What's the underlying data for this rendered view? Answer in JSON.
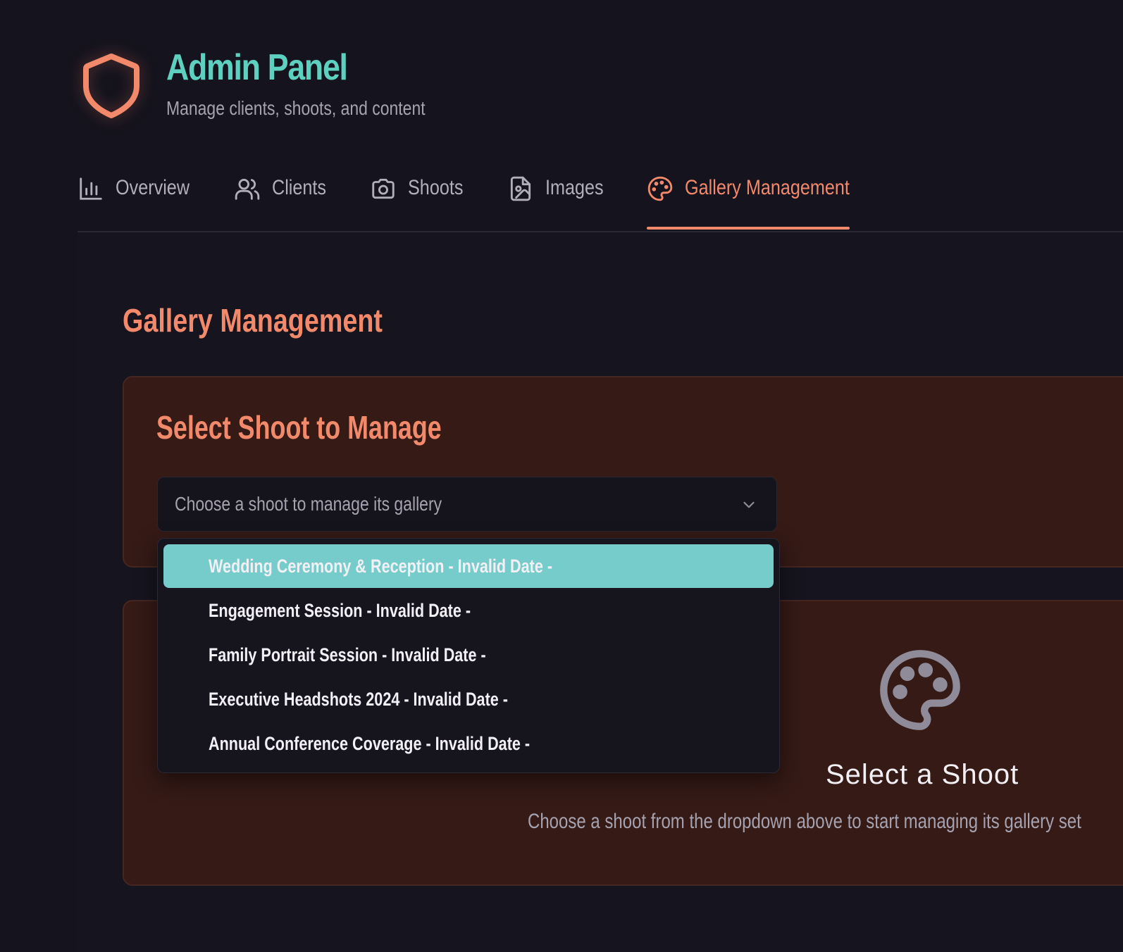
{
  "header": {
    "title": "Admin Panel",
    "subtitle": "Manage clients, shoots, and content",
    "icon": "shield-icon"
  },
  "tabs": [
    {
      "label": "Overview",
      "icon": "bar-chart-icon",
      "active": false
    },
    {
      "label": "Clients",
      "icon": "users-icon",
      "active": false
    },
    {
      "label": "Shoots",
      "icon": "camera-icon",
      "active": false
    },
    {
      "label": "Images",
      "icon": "file-image-icon",
      "active": false
    },
    {
      "label": "Gallery Management",
      "icon": "palette-icon",
      "active": true
    }
  ],
  "section": {
    "title": "Gallery Management"
  },
  "select_card": {
    "title": "Select Shoot to Manage",
    "placeholder": "Choose a shoot to manage its gallery",
    "options": [
      "Wedding Ceremony & Reception - Invalid Date -",
      "Engagement Session - Invalid Date -",
      "Family Portrait Session - Invalid Date -",
      "Executive Headshots 2024 - Invalid Date -",
      "Annual Conference Coverage - Invalid Date -"
    ],
    "highlighted_index": 0
  },
  "empty_state": {
    "icon": "palette-icon",
    "title": "Select a Shoot",
    "description": "Choose a shoot from the dropdown above to start managing its gallery set"
  },
  "colors": {
    "background": "#15131d",
    "accent": "#f2896b",
    "brand": "#5ed0c0",
    "highlight": "#76ccca",
    "card": "#351a16"
  }
}
